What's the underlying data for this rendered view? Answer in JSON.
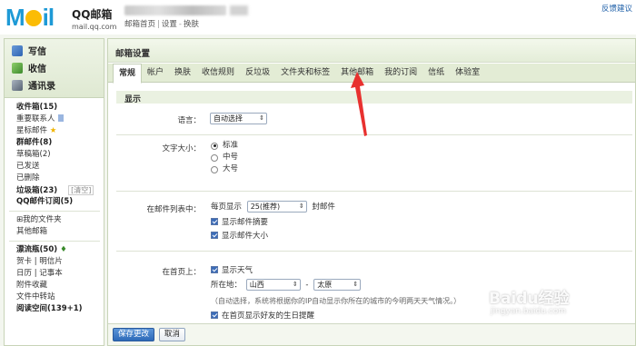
{
  "header": {
    "brand_title": "QQ邮箱",
    "brand_url": "mail.qq.com",
    "top_links": [
      "邮箱首页",
      "设置",
      "换肤"
    ],
    "right_link": "反馈建议"
  },
  "sidebar": {
    "primary": [
      {
        "label": "写信",
        "icon": "write-icon"
      },
      {
        "label": "收信",
        "icon": "inbox-icon"
      },
      {
        "label": "通讯录",
        "icon": "contacts-icon"
      }
    ],
    "folders": [
      {
        "label": "收件箱",
        "count": "(15)",
        "bold": true
      },
      {
        "label": "重要联系人",
        "bold": false
      },
      {
        "label": "星标邮件",
        "bold": false
      },
      {
        "label": "群邮件",
        "count": "(8)",
        "bold": true
      },
      {
        "label": "草稿箱",
        "count": "(2)",
        "bold": false
      },
      {
        "label": "已发送",
        "bold": false
      },
      {
        "label": "已删除",
        "bold": false
      },
      {
        "label": "垃圾箱",
        "count": "(23)",
        "bold": true,
        "clear": "[清空]"
      },
      {
        "label": "QQ邮件订阅",
        "count": "(5)",
        "bold": true
      }
    ],
    "extra": [
      "我的文件夹",
      "其他邮箱"
    ],
    "apps": [
      {
        "label": "漂流瓶",
        "count": "(50)",
        "bold": true
      },
      {
        "label": "贺卡 | 明信片",
        "bold": false
      },
      {
        "label": "日历 | 记事本",
        "bold": false
      },
      {
        "label": "附件收藏",
        "bold": false
      },
      {
        "label": "文件中转站",
        "bold": false
      },
      {
        "label": "阅读空间",
        "count": "(139+1)",
        "bold": true
      }
    ]
  },
  "main": {
    "title": "邮箱设置",
    "tabs": [
      "常规",
      "帐户",
      "换肤",
      "收信规则",
      "反垃圾",
      "文件夹和标签",
      "其他邮箱",
      "我的订阅",
      "信纸",
      "体验室"
    ],
    "active_tab": "常规",
    "section_title": "显示",
    "language": {
      "label": "语言：",
      "value": "自动选择"
    },
    "font_size": {
      "label": "文字大小：",
      "options": [
        "标准",
        "中号",
        "大号"
      ],
      "selected": "标准"
    },
    "list": {
      "label": "在邮件列表中：",
      "per_page_prefix": "每页显示",
      "per_page_value": "25(推荐)",
      "per_page_suffix": "封邮件",
      "show_summary": "显示邮件摘要",
      "show_size": "显示邮件大小"
    },
    "home": {
      "label": "在首页上：",
      "show_weather": "显示天气",
      "location_label": "所在地：",
      "province": "山西",
      "dash": "-",
      "city": "太原",
      "hint": "（自动选择，系统将根据你的IP自动显示你所在的城市的今明两天天气情况。）",
      "birthday": "在首页显示好友的生日提醒"
    },
    "buttons": {
      "save": "保存更改",
      "cancel": "取消"
    }
  },
  "watermark": {
    "text": "Baidu经验",
    "sub": "jingyan.baidu.com"
  },
  "colors": {
    "accent": "#1e9ad6",
    "tab_bg": "#e3ecd5",
    "arrow": "#e8312f"
  }
}
